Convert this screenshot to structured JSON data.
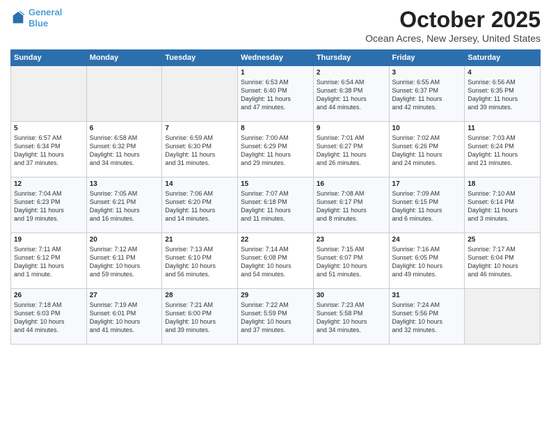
{
  "header": {
    "logo_line1": "General",
    "logo_line2": "Blue",
    "title": "October 2025",
    "subtitle": "Ocean Acres, New Jersey, United States"
  },
  "weekdays": [
    "Sunday",
    "Monday",
    "Tuesday",
    "Wednesday",
    "Thursday",
    "Friday",
    "Saturday"
  ],
  "weeks": [
    [
      {
        "day": "",
        "detail": ""
      },
      {
        "day": "",
        "detail": ""
      },
      {
        "day": "",
        "detail": ""
      },
      {
        "day": "1",
        "detail": "Sunrise: 6:53 AM\nSunset: 6:40 PM\nDaylight: 11 hours\nand 47 minutes."
      },
      {
        "day": "2",
        "detail": "Sunrise: 6:54 AM\nSunset: 6:38 PM\nDaylight: 11 hours\nand 44 minutes."
      },
      {
        "day": "3",
        "detail": "Sunrise: 6:55 AM\nSunset: 6:37 PM\nDaylight: 11 hours\nand 42 minutes."
      },
      {
        "day": "4",
        "detail": "Sunrise: 6:56 AM\nSunset: 6:35 PM\nDaylight: 11 hours\nand 39 minutes."
      }
    ],
    [
      {
        "day": "5",
        "detail": "Sunrise: 6:57 AM\nSunset: 6:34 PM\nDaylight: 11 hours\nand 37 minutes."
      },
      {
        "day": "6",
        "detail": "Sunrise: 6:58 AM\nSunset: 6:32 PM\nDaylight: 11 hours\nand 34 minutes."
      },
      {
        "day": "7",
        "detail": "Sunrise: 6:59 AM\nSunset: 6:30 PM\nDaylight: 11 hours\nand 31 minutes."
      },
      {
        "day": "8",
        "detail": "Sunrise: 7:00 AM\nSunset: 6:29 PM\nDaylight: 11 hours\nand 29 minutes."
      },
      {
        "day": "9",
        "detail": "Sunrise: 7:01 AM\nSunset: 6:27 PM\nDaylight: 11 hours\nand 26 minutes."
      },
      {
        "day": "10",
        "detail": "Sunrise: 7:02 AM\nSunset: 6:26 PM\nDaylight: 11 hours\nand 24 minutes."
      },
      {
        "day": "11",
        "detail": "Sunrise: 7:03 AM\nSunset: 6:24 PM\nDaylight: 11 hours\nand 21 minutes."
      }
    ],
    [
      {
        "day": "12",
        "detail": "Sunrise: 7:04 AM\nSunset: 6:23 PM\nDaylight: 11 hours\nand 19 minutes."
      },
      {
        "day": "13",
        "detail": "Sunrise: 7:05 AM\nSunset: 6:21 PM\nDaylight: 11 hours\nand 16 minutes."
      },
      {
        "day": "14",
        "detail": "Sunrise: 7:06 AM\nSunset: 6:20 PM\nDaylight: 11 hours\nand 14 minutes."
      },
      {
        "day": "15",
        "detail": "Sunrise: 7:07 AM\nSunset: 6:18 PM\nDaylight: 11 hours\nand 11 minutes."
      },
      {
        "day": "16",
        "detail": "Sunrise: 7:08 AM\nSunset: 6:17 PM\nDaylight: 11 hours\nand 8 minutes."
      },
      {
        "day": "17",
        "detail": "Sunrise: 7:09 AM\nSunset: 6:15 PM\nDaylight: 11 hours\nand 6 minutes."
      },
      {
        "day": "18",
        "detail": "Sunrise: 7:10 AM\nSunset: 6:14 PM\nDaylight: 11 hours\nand 3 minutes."
      }
    ],
    [
      {
        "day": "19",
        "detail": "Sunrise: 7:11 AM\nSunset: 6:12 PM\nDaylight: 11 hours\nand 1 minute."
      },
      {
        "day": "20",
        "detail": "Sunrise: 7:12 AM\nSunset: 6:11 PM\nDaylight: 10 hours\nand 59 minutes."
      },
      {
        "day": "21",
        "detail": "Sunrise: 7:13 AM\nSunset: 6:10 PM\nDaylight: 10 hours\nand 56 minutes."
      },
      {
        "day": "22",
        "detail": "Sunrise: 7:14 AM\nSunset: 6:08 PM\nDaylight: 10 hours\nand 54 minutes."
      },
      {
        "day": "23",
        "detail": "Sunrise: 7:15 AM\nSunset: 6:07 PM\nDaylight: 10 hours\nand 51 minutes."
      },
      {
        "day": "24",
        "detail": "Sunrise: 7:16 AM\nSunset: 6:05 PM\nDaylight: 10 hours\nand 49 minutes."
      },
      {
        "day": "25",
        "detail": "Sunrise: 7:17 AM\nSunset: 6:04 PM\nDaylight: 10 hours\nand 46 minutes."
      }
    ],
    [
      {
        "day": "26",
        "detail": "Sunrise: 7:18 AM\nSunset: 6:03 PM\nDaylight: 10 hours\nand 44 minutes."
      },
      {
        "day": "27",
        "detail": "Sunrise: 7:19 AM\nSunset: 6:01 PM\nDaylight: 10 hours\nand 41 minutes."
      },
      {
        "day": "28",
        "detail": "Sunrise: 7:21 AM\nSunset: 6:00 PM\nDaylight: 10 hours\nand 39 minutes."
      },
      {
        "day": "29",
        "detail": "Sunrise: 7:22 AM\nSunset: 5:59 PM\nDaylight: 10 hours\nand 37 minutes."
      },
      {
        "day": "30",
        "detail": "Sunrise: 7:23 AM\nSunset: 5:58 PM\nDaylight: 10 hours\nand 34 minutes."
      },
      {
        "day": "31",
        "detail": "Sunrise: 7:24 AM\nSunset: 5:56 PM\nDaylight: 10 hours\nand 32 minutes."
      },
      {
        "day": "",
        "detail": ""
      }
    ]
  ]
}
